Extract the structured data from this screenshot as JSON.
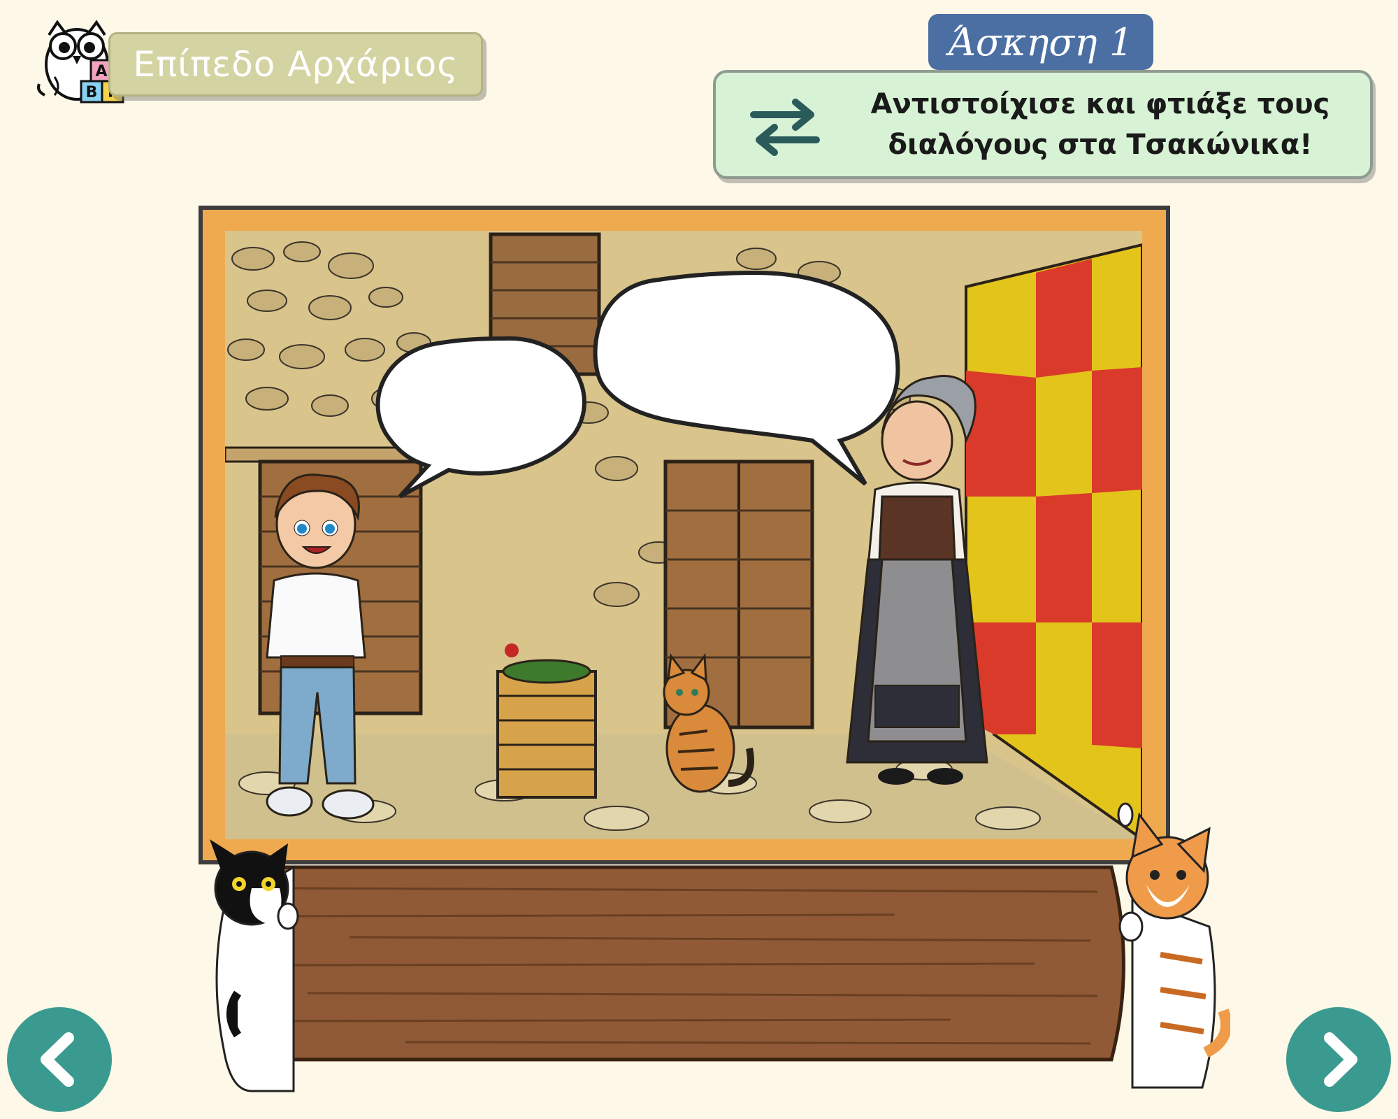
{
  "level": {
    "label": "Επίπεδο Αρχάριος",
    "badge_letters": [
      "Α",
      "Β",
      "Γ"
    ]
  },
  "exercise": {
    "title": "Άσκηση 1",
    "instruction_line1": "Αντιστοίχισε και φτιάξε τους",
    "instruction_line2": "διαλόγους στα Τσακώνικα!",
    "icon": "swap-arrows-icon"
  },
  "scene": {
    "characters": [
      "boy",
      "grandmother",
      "tabby-cat"
    ],
    "speech_bubbles": [
      {
        "speaker": "boy",
        "text": ""
      },
      {
        "speaker": "grandmother",
        "text": ""
      }
    ],
    "answer_board_text": ""
  },
  "navigation": {
    "prev_icon": "chevron-left-icon",
    "next_icon": "chevron-right-icon"
  },
  "colors": {
    "background": "#fdf8e8",
    "level_pill": "#d4d3a2",
    "exercise_tab": "#4b6fa3",
    "instruction_box": "#d7f2d5",
    "frame": "#efa94f",
    "board": "#8f5a35",
    "nav_button": "#3a9a8f"
  }
}
